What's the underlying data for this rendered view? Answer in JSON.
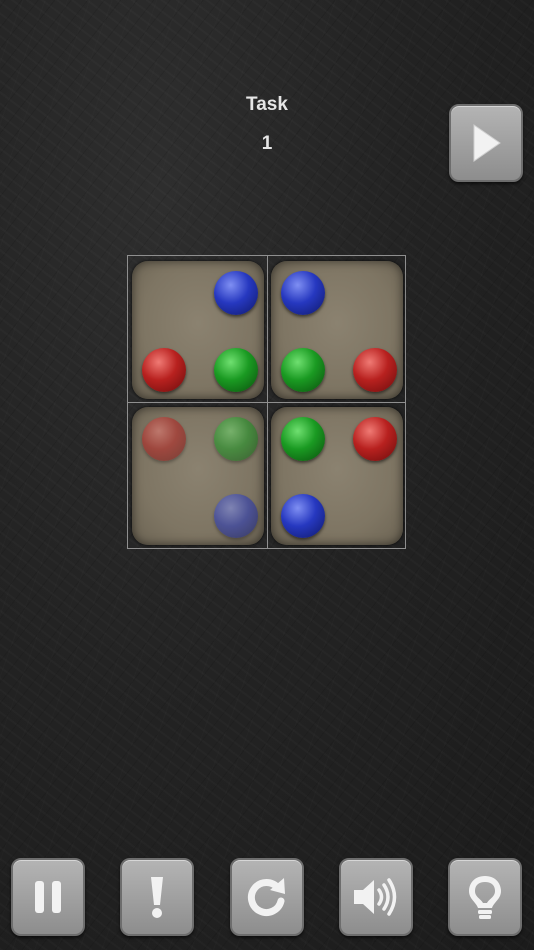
{
  "header": {
    "task_label": "Task",
    "task_number": "1"
  },
  "buttons": [
    {
      "name": "pause-button",
      "icon": "pause-icon"
    },
    {
      "name": "hint-exclamation-button",
      "icon": "exclamation-icon"
    },
    {
      "name": "restart-button",
      "icon": "restart-icon"
    },
    {
      "name": "sound-button",
      "icon": "speaker-icon"
    },
    {
      "name": "lightbulb-hint-button",
      "icon": "lightbulb-icon"
    }
  ],
  "next_button": {
    "icon": "play-icon"
  },
  "colors": {
    "red": "#c0282a",
    "green": "#1f9a25",
    "blue": "#2a3fc4",
    "tile": "#7f7664",
    "button": "#a3a3a3"
  },
  "board": {
    "tiles": [
      {
        "balls": [
          {
            "color": "blue",
            "pos": "top-right"
          },
          {
            "color": "red",
            "pos": "bottom-left"
          },
          {
            "color": "green",
            "pos": "bottom-right"
          }
        ]
      },
      {
        "balls": [
          {
            "color": "blue",
            "pos": "top-left"
          },
          {
            "color": "green",
            "pos": "bottom-left"
          },
          {
            "color": "red",
            "pos": "bottom-right"
          }
        ]
      },
      {
        "balls": [
          {
            "color": "red",
            "pos": "top-left",
            "faded": true
          },
          {
            "color": "green",
            "pos": "top-right",
            "faded": true
          },
          {
            "color": "blue",
            "pos": "bottom-right",
            "faded": true
          }
        ]
      },
      {
        "balls": [
          {
            "color": "green",
            "pos": "top-left"
          },
          {
            "color": "red",
            "pos": "top-right"
          },
          {
            "color": "blue",
            "pos": "bottom-left"
          }
        ]
      }
    ]
  }
}
